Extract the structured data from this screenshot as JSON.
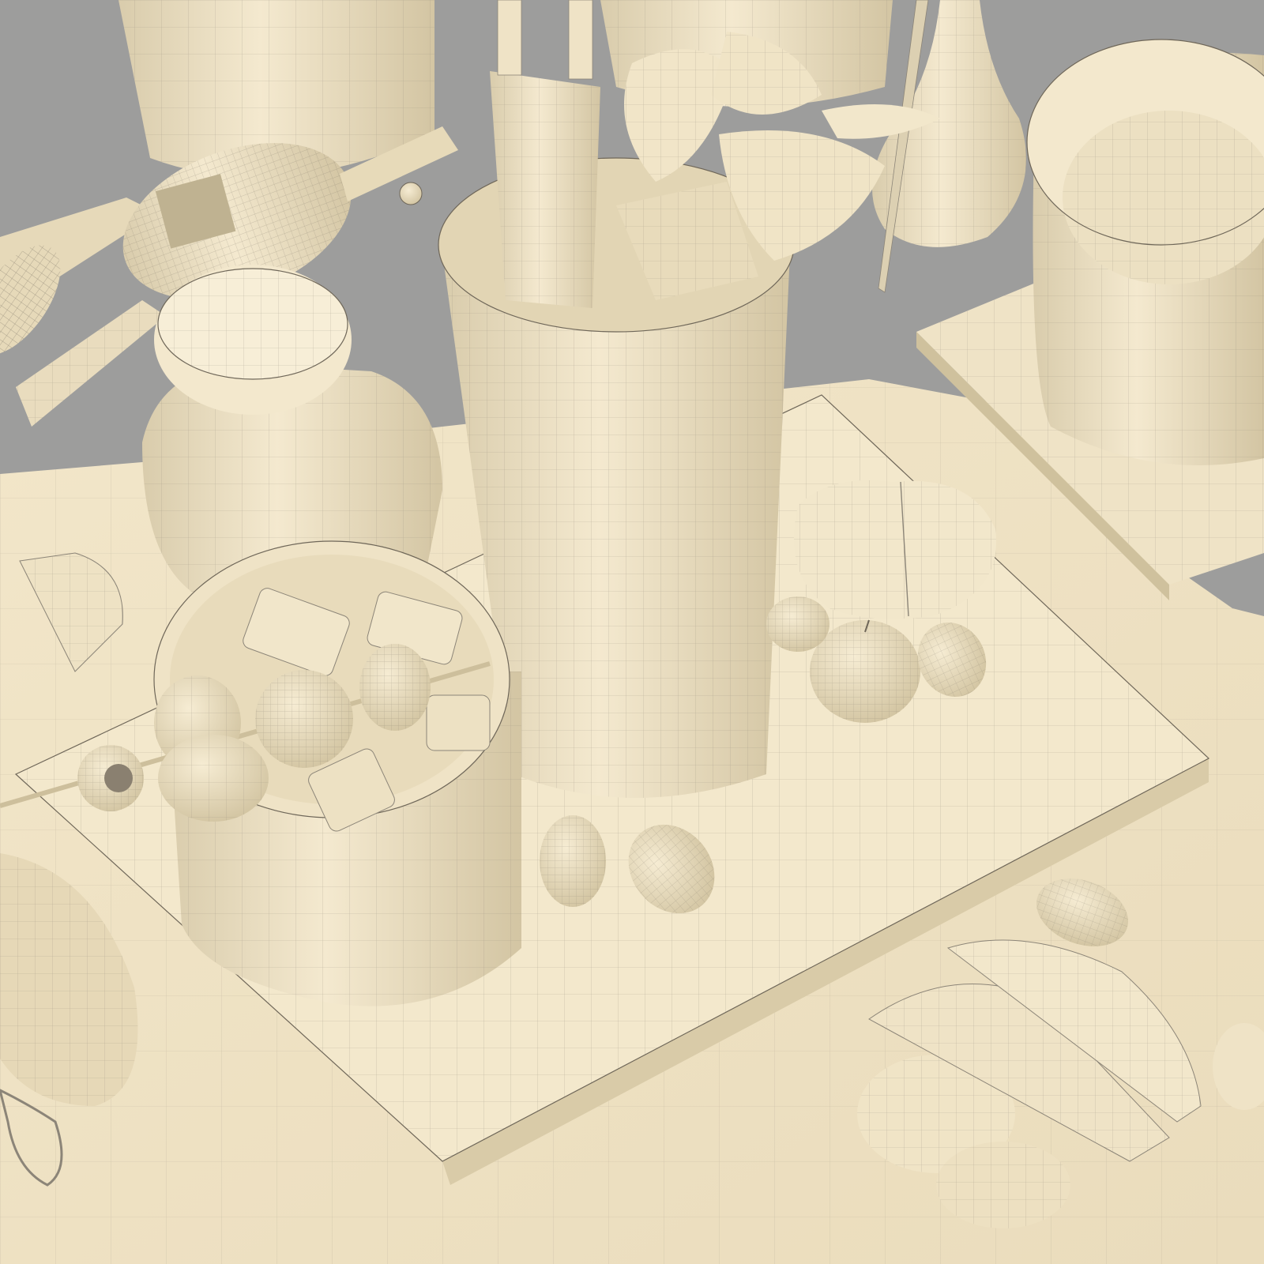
{
  "scene": {
    "kind": "wireframe-render",
    "subject": "kitchen-still-life",
    "colors": {
      "background": "#9d9d9c",
      "clay": "#efe3c6",
      "clay_shadow": "#d9ccac",
      "clay_dark": "#c4b692",
      "wire": "#8c8578"
    }
  }
}
